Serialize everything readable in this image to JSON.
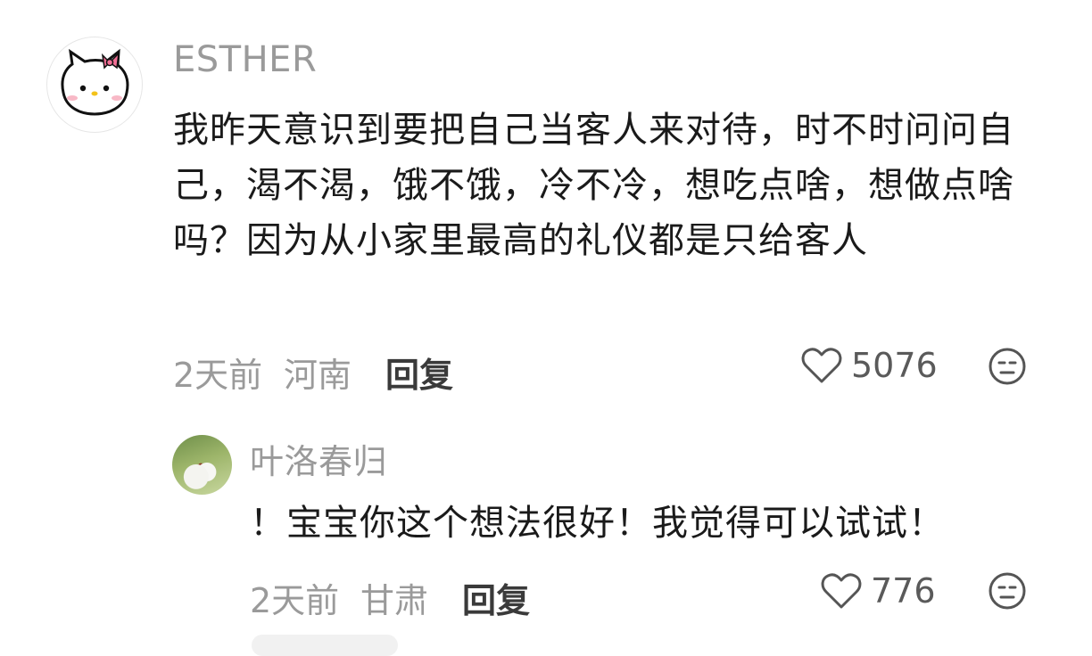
{
  "comments": [
    {
      "username": "ESTHER",
      "text": "我昨天意识到要把自己当客人来对待，时不时问问自己，渴不渴，饿不饿，冷不冷，想吃点啥，想做点啥吗？因为从小家里最高的礼仪都是只给客人",
      "time": "2天前",
      "location": "河南",
      "reply_label": "回复",
      "likes": "5076"
    }
  ],
  "replies": [
    {
      "username": "叶洛春归",
      "text": "！宝宝你这个想法很好！我觉得可以试试！",
      "time": "2天前",
      "location": "甘肃",
      "reply_label": "回复",
      "likes": "776"
    }
  ],
  "icons": {
    "like": "heart-outline-icon",
    "dislike": "neutral-face-icon"
  },
  "colors": {
    "meta_gray": "#9a9a9a",
    "text": "#1a1a1a"
  }
}
